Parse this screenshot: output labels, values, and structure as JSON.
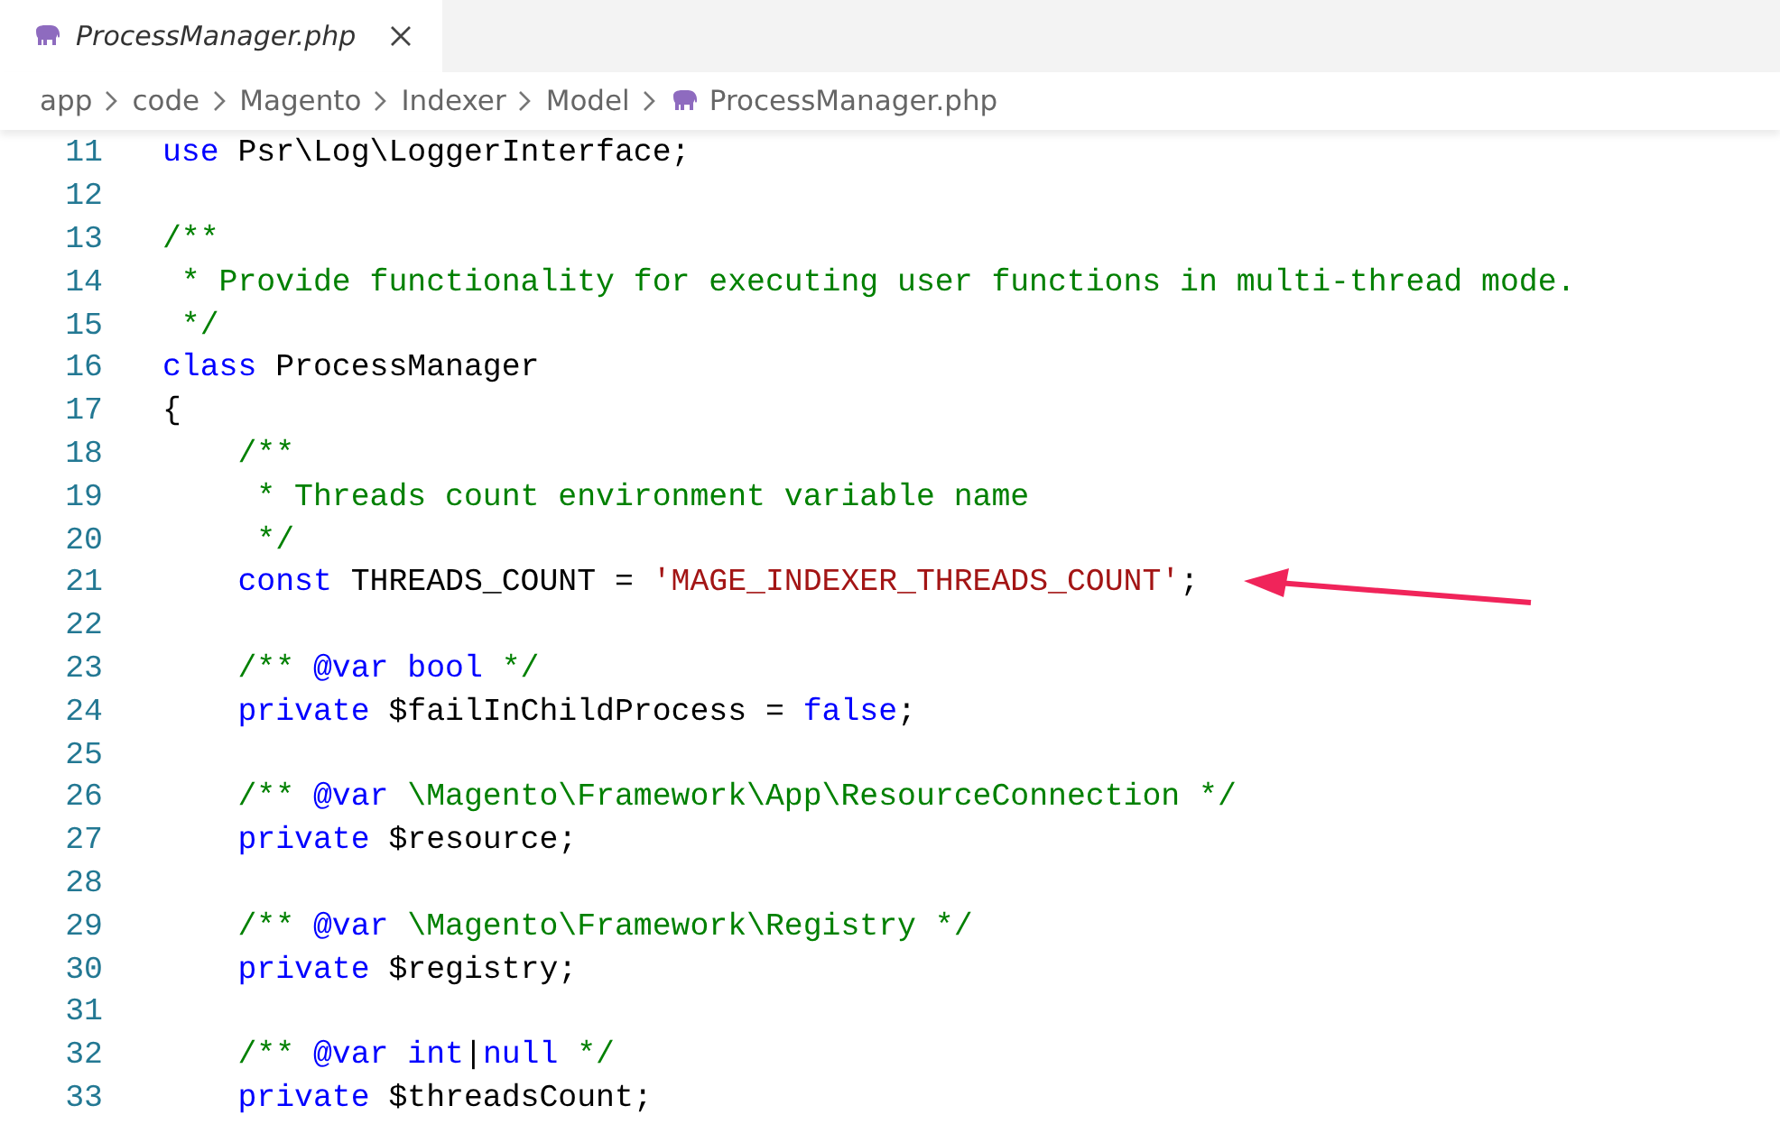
{
  "tabs": [
    {
      "label": "ProcessManager.php",
      "selected": true
    }
  ],
  "breadcrumb": [
    {
      "text": "app",
      "kind": "folder"
    },
    {
      "text": "code",
      "kind": "folder"
    },
    {
      "text": "Magento",
      "kind": "folder"
    },
    {
      "text": "Indexer",
      "kind": "folder"
    },
    {
      "text": "Model",
      "kind": "folder"
    },
    {
      "text": "ProcessManager.php",
      "kind": "file"
    }
  ],
  "lines": [
    {
      "number": "11",
      "tokens": [
        {
          "kind": "keyword",
          "text": "use"
        },
        {
          "kind": "plain",
          "text": " Psr\\Log\\LoggerInterface;"
        }
      ]
    },
    {
      "number": "12"
    },
    {
      "number": "13",
      "tokens": [
        {
          "kind": "comment",
          "text": "/**"
        }
      ]
    },
    {
      "number": "14",
      "tokens": [
        {
          "kind": "comment",
          "text": " * Provide functionality for executing user functions in multi-thread mode."
        }
      ]
    },
    {
      "number": "15",
      "tokens": [
        {
          "kind": "comment",
          "text": " */"
        }
      ]
    },
    {
      "number": "16",
      "tokens": [
        {
          "kind": "keyword",
          "text": "class"
        },
        {
          "kind": "plain",
          "text": " ProcessManager"
        }
      ]
    },
    {
      "number": "17",
      "tokens": [
        {
          "kind": "plain",
          "text": "{"
        }
      ]
    },
    {
      "number": "18",
      "tokens": [
        {
          "kind": "comment",
          "text": "    /**"
        }
      ]
    },
    {
      "number": "19",
      "tokens": [
        {
          "kind": "comment",
          "text": "     * Threads count environment variable name"
        }
      ]
    },
    {
      "number": "20",
      "tokens": [
        {
          "kind": "comment",
          "text": "     */"
        }
      ]
    },
    {
      "number": "21",
      "tokens": [
        {
          "kind": "keyword",
          "text": "    const"
        },
        {
          "kind": "plain",
          "text": " THREADS_COUNT = "
        },
        {
          "kind": "string",
          "text": "'MAGE_INDEXER_THREADS_COUNT'"
        },
        {
          "kind": "plain",
          "text": ";"
        }
      ]
    },
    {
      "number": "22"
    },
    {
      "number": "23",
      "tokens": [
        {
          "kind": "comment",
          "text": "    /** "
        },
        {
          "kind": "keyword",
          "text": "@var bool"
        },
        {
          "kind": "comment",
          "text": " */"
        }
      ]
    },
    {
      "number": "24",
      "tokens": [
        {
          "kind": "keyword",
          "text": "    private"
        },
        {
          "kind": "plain",
          "text": " $failInChildProcess = "
        },
        {
          "kind": "keyword",
          "text": "false"
        },
        {
          "kind": "plain",
          "text": ";"
        }
      ]
    },
    {
      "number": "25"
    },
    {
      "number": "26",
      "tokens": [
        {
          "kind": "comment",
          "text": "    /** "
        },
        {
          "kind": "keyword",
          "text": "@var"
        },
        {
          "kind": "comment",
          "text": " \\Magento\\Framework\\App\\ResourceConnection */"
        }
      ]
    },
    {
      "number": "27",
      "tokens": [
        {
          "kind": "keyword",
          "text": "    private"
        },
        {
          "kind": "plain",
          "text": " $resource;"
        }
      ]
    },
    {
      "number": "28"
    },
    {
      "number": "29",
      "tokens": [
        {
          "kind": "comment",
          "text": "    /** "
        },
        {
          "kind": "keyword",
          "text": "@var"
        },
        {
          "kind": "comment",
          "text": " \\Magento\\Framework\\Registry */"
        }
      ]
    },
    {
      "number": "30",
      "tokens": [
        {
          "kind": "keyword",
          "text": "    private"
        },
        {
          "kind": "plain",
          "text": " $registry;"
        }
      ]
    },
    {
      "number": "31"
    },
    {
      "number": "32",
      "tokens": [
        {
          "kind": "comment",
          "text": "    /** "
        },
        {
          "kind": "keyword",
          "text": "@var int"
        },
        {
          "kind": "plain",
          "text": "|"
        },
        {
          "kind": "keyword",
          "text": "null"
        },
        {
          "kind": "comment",
          "text": " */"
        }
      ]
    },
    {
      "number": "33",
      "tokens": [
        {
          "kind": "keyword",
          "text": "    private"
        },
        {
          "kind": "plain",
          "text": " $threadsCount;"
        }
      ]
    }
  ]
}
